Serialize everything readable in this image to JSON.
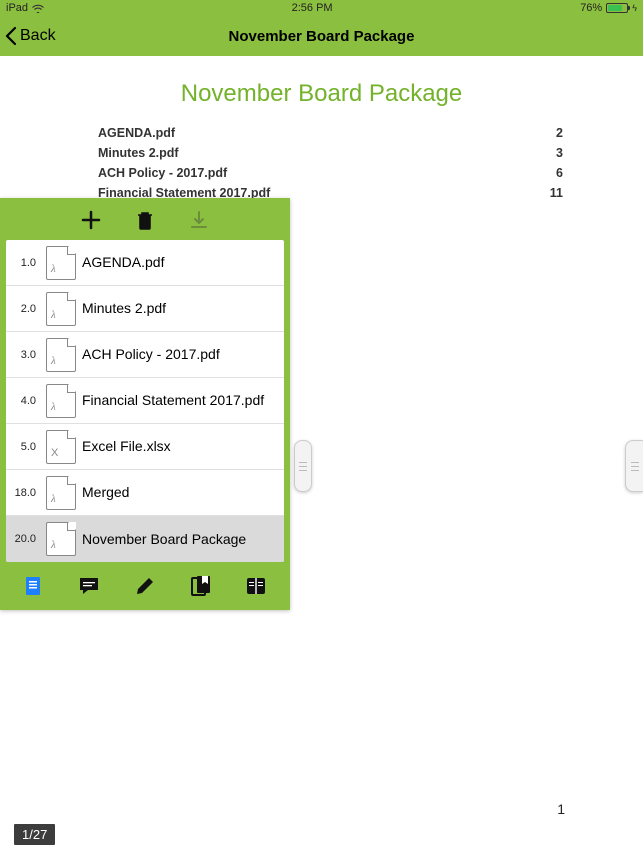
{
  "status": {
    "device": "iPad",
    "time": "2:56 PM",
    "battery": "76%"
  },
  "nav": {
    "back": "Back",
    "title": "November Board Package"
  },
  "documentTitle": "November Board Package",
  "toc": [
    {
      "name": "AGENDA.pdf",
      "page": "2"
    },
    {
      "name": "Minutes 2.pdf",
      "page": "3"
    },
    {
      "name": "ACH Policy - 2017.pdf",
      "page": "6"
    },
    {
      "name": "Financial Statement 2017.pdf",
      "page": "11"
    }
  ],
  "files": [
    {
      "num": "1.0",
      "type": "pdf",
      "name": "AGENDA.pdf",
      "selected": false
    },
    {
      "num": "2.0",
      "type": "pdf",
      "name": "Minutes 2.pdf",
      "selected": false
    },
    {
      "num": "3.0",
      "type": "pdf",
      "name": "ACH Policy - 2017.pdf",
      "selected": false
    },
    {
      "num": "4.0",
      "type": "pdf",
      "name": "Financial Statement 2017.pdf",
      "selected": false
    },
    {
      "num": "5.0",
      "type": "xls",
      "name": "Excel File.xlsx",
      "selected": false
    },
    {
      "num": "18.0",
      "type": "pdf",
      "name": "Merged",
      "selected": false
    },
    {
      "num": "20.0",
      "type": "pdf",
      "name": "November Board Package",
      "selected": true
    }
  ],
  "currentPage": "1",
  "pageIndicator": "1/27"
}
